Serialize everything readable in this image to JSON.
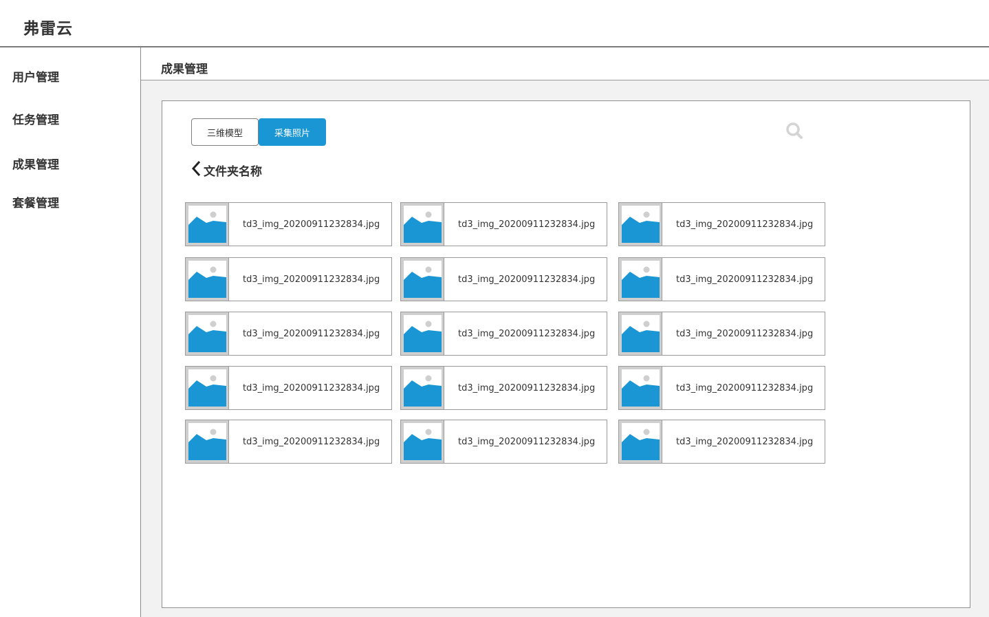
{
  "app": {
    "title": "弗雷云"
  },
  "sidebar": {
    "items": [
      {
        "label": "用户管理"
      },
      {
        "label": "任务管理"
      },
      {
        "label": "成果管理"
      },
      {
        "label": "套餐管理"
      }
    ]
  },
  "header": {
    "title": "成果管理"
  },
  "tabs": [
    {
      "label": "三维模型",
      "active": false
    },
    {
      "label": "采集照片",
      "active": true
    }
  ],
  "search": {
    "icon": "search-icon"
  },
  "folder": {
    "back_icon": "chevron-left-icon",
    "name": "文件夹名称"
  },
  "files": [
    {
      "name": "td3_img_20200911232834.jpg"
    },
    {
      "name": "td3_img_20200911232834.jpg"
    },
    {
      "name": "td3_img_20200911232834.jpg"
    },
    {
      "name": "td3_img_20200911232834.jpg"
    },
    {
      "name": "td3_img_20200911232834.jpg"
    },
    {
      "name": "td3_img_20200911232834.jpg"
    },
    {
      "name": "td3_img_20200911232834.jpg"
    },
    {
      "name": "td3_img_20200911232834.jpg"
    },
    {
      "name": "td3_img_20200911232834.jpg"
    },
    {
      "name": "td3_img_20200911232834.jpg"
    },
    {
      "name": "td3_img_20200911232834.jpg"
    },
    {
      "name": "td3_img_20200911232834.jpg"
    },
    {
      "name": "td3_img_20200911232834.jpg"
    },
    {
      "name": "td3_img_20200911232834.jpg"
    },
    {
      "name": "td3_img_20200911232834.jpg"
    }
  ],
  "colors": {
    "accent": "#1a96d4",
    "thumb_bg": "#cfcfcf"
  }
}
